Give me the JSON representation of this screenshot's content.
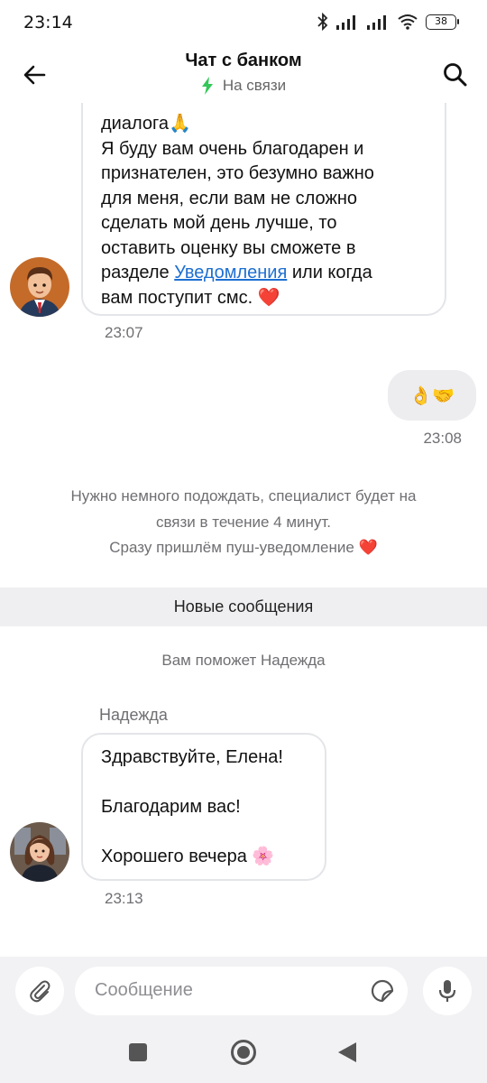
{
  "status_bar": {
    "time": "23:14",
    "battery": "38"
  },
  "header": {
    "title": "Чат с банком",
    "status": "На связи",
    "status_color": "#34c759"
  },
  "messages": {
    "bank_message": {
      "line1": "диалога",
      "line1_emoji": "🙏",
      "line2": "Я буду вам очень благодарен и",
      "line3": "признателен, это безумно важно",
      "line4": "для меня, если вам не сложно",
      "line5": "сделать мой день лучше, то",
      "line6": "оставить оценку вы сможете в",
      "line7_prefix": "разделе ",
      "line7_link": "Уведомления",
      "line7_suffix": " или когда",
      "line8": "вам поступит смс.",
      "line8_emoji": "❤️",
      "time": "23:07"
    },
    "user_message": {
      "text": "👌🤝",
      "time": "23:08"
    },
    "system_wait": {
      "line1": "Нужно немного подождать, специалист будет на",
      "line2": "связи в течение 4 минут.",
      "line3": "Сразу пришлём пуш-уведомление ❤️"
    },
    "divider": "Новые сообщения",
    "assigned": "Вам поможет Надежда",
    "operator": {
      "name": "Надежда",
      "line1": "Здравствуйте, Елена!",
      "line2": "Благодарим вас!",
      "line3": "Хорошего вечера 🌸",
      "time": "23:13"
    }
  },
  "composer": {
    "placeholder": "Сообщение"
  },
  "colors": {
    "accent_link": "#1d6fd1",
    "bubble_out": "#ededf0",
    "divider_bg": "#efeff1"
  }
}
